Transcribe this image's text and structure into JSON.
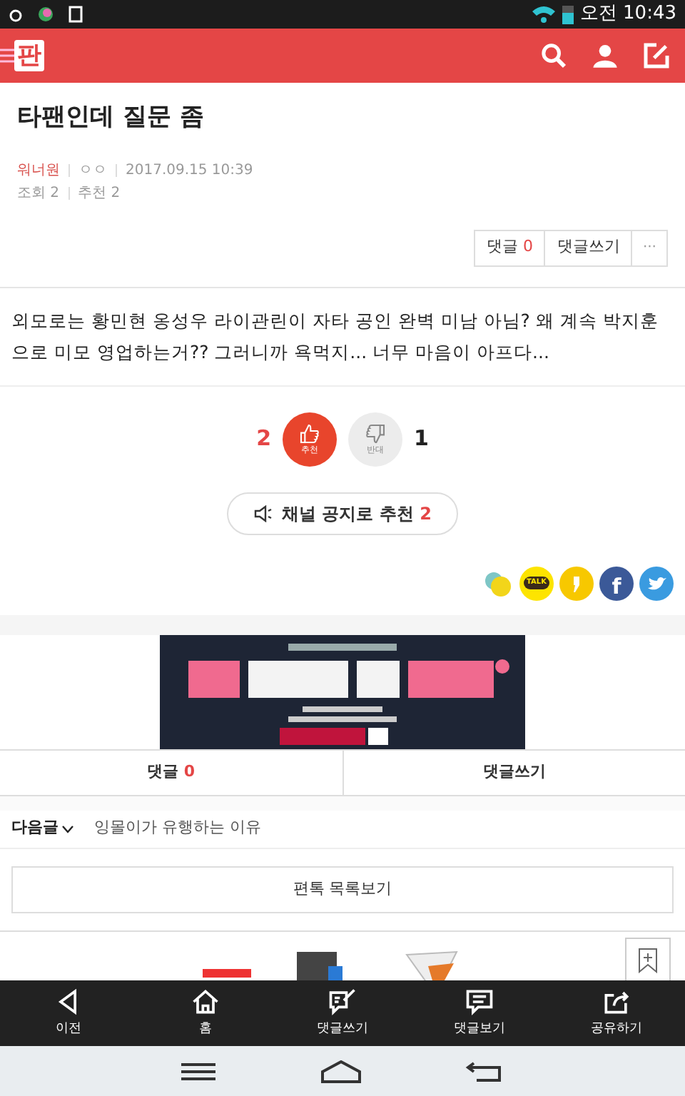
{
  "status_bar": {
    "time": "오전 10:43"
  },
  "header": {
    "logo": "판"
  },
  "post": {
    "title": "타팬인데 질문 좀",
    "author": "워너원",
    "nickname": "ㅇㅇ",
    "date": "2017.09.15 10:39",
    "views": "조회 2",
    "recommends": "추천 2",
    "actions": [
      {
        "kind": "count",
        "label": "댓글",
        "count": "0"
      },
      {
        "kind": "plain",
        "label": "댓글쓰기"
      },
      {
        "kind": "more",
        "label": "···"
      }
    ],
    "body": "외모로는 황민현 옹성우 라이관린이 자타 공인 완벽 미남 아님? 왜 계속 박지훈으로 미모 영업하는거?? 그러니까 욕먹지... 너무 마음이 아프다..."
  },
  "votes": [
    {
      "kind": "up",
      "count": "2",
      "label": "추천",
      "selected": true
    },
    {
      "kind": "down",
      "count": "1",
      "label": "반대",
      "selected": false
    }
  ],
  "notice_button": {
    "label": "채널 공지로 추천",
    "count": "2"
  },
  "share": [
    {
      "kind": "band"
    },
    {
      "kind": "kakaotalk",
      "label": "TALK"
    },
    {
      "kind": "kakaostory"
    },
    {
      "kind": "facebook",
      "label": "f"
    },
    {
      "kind": "twitter"
    }
  ],
  "comment_bar": [
    {
      "label": "댓글",
      "count": "0"
    },
    {
      "label": "댓글쓰기"
    }
  ],
  "next_post": {
    "label": "다음글",
    "title": "잉몰이가 유행하는 이유"
  },
  "list_button": "편톡 목록보기",
  "bottom_nav": [
    {
      "kind": "back",
      "label": "이전"
    },
    {
      "kind": "home",
      "label": "홈"
    },
    {
      "kind": "write",
      "label": "댓글쓰기"
    },
    {
      "kind": "comments",
      "label": "댓글보기"
    },
    {
      "kind": "share",
      "label": "공유하기"
    }
  ]
}
